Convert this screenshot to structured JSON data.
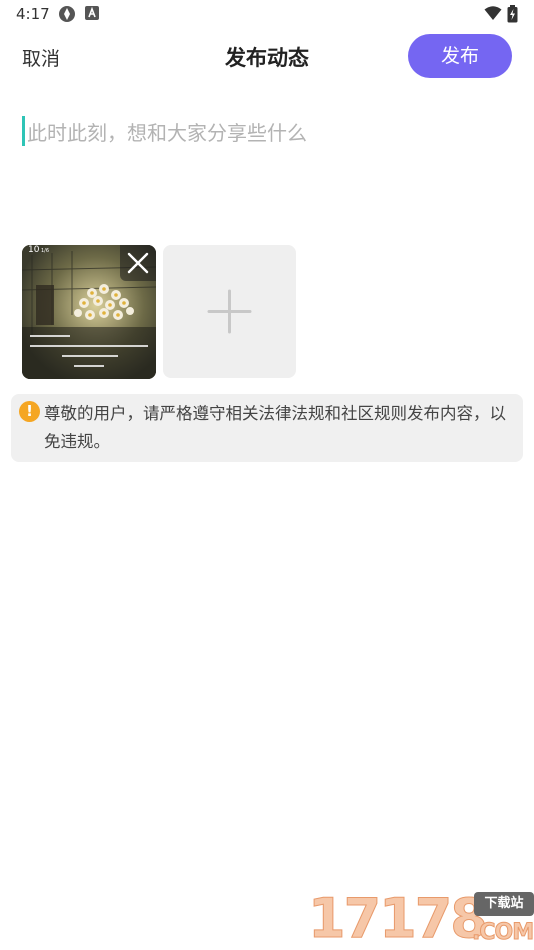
{
  "status_bar": {
    "time": "4:17"
  },
  "header": {
    "cancel_label": "取消",
    "title": "发布动态",
    "publish_label": "发布",
    "accent_color": "#7566f2"
  },
  "editor": {
    "placeholder": "此时此刻，想和大家分享些什么"
  },
  "media": {
    "photos": [
      {
        "overlay_date": "10",
        "overlay_month": "1/6"
      }
    ],
    "add_icon": "plus-icon",
    "remove_icon": "close-icon"
  },
  "notice": {
    "icon": "warning-icon",
    "icon_glyph": "!",
    "text": "尊敬的用户，请严格遵守相关法律法规和社区规则发布内容，以免违规。",
    "icon_color": "#f5a623"
  },
  "watermark": {
    "digits": "17178",
    "badge": "下载站",
    "suffix": ".COM"
  }
}
